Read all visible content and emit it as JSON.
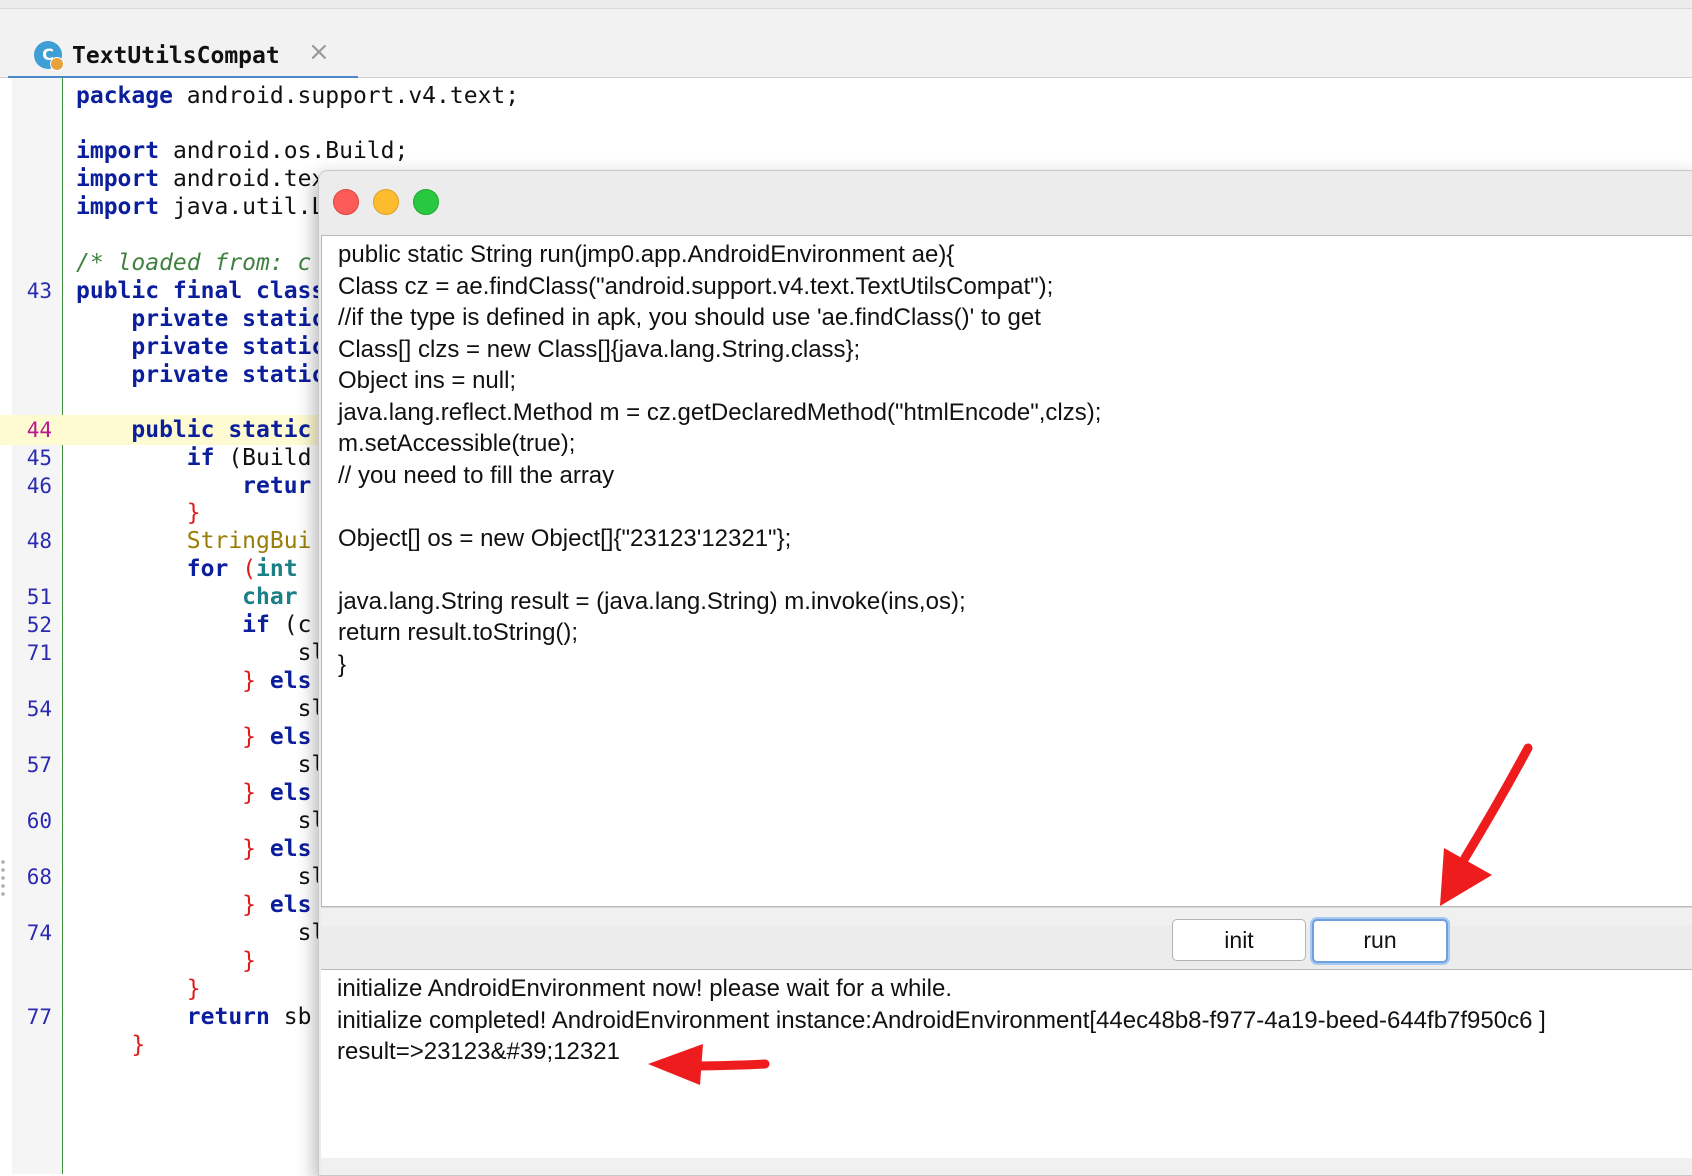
{
  "editor_tab": {
    "icon_letter": "C",
    "title": "TextUtilsCompat",
    "close": "×"
  },
  "code": {
    "package_kw": "package",
    "package_name": " android.support.v4.text;",
    "import_kw": "import",
    "imports": [
      " android.os.Build;",
      " android.tex",
      " java.util.L"
    ],
    "comment": "/* loaded from: c",
    "class_decl_kw": "public final class",
    "private_kw": "private static",
    "method_kw": "public static",
    "if_kw": "if",
    "if_rest": " (Build",
    "return_kw": "return",
    "return_partial": "retur",
    "builder": "StringBui",
    "for_kw": "for",
    "int_kw": "int",
    "char_kw": "char",
    "if_c": " (c",
    "else_kw": "else",
    "else_partial": "els",
    "sb_partial": "sl",
    "return_sb": " sb",
    "line_numbers": {
      "l43": "43",
      "l44": "44",
      "l45": "45",
      "l46": "46",
      "l48": "48",
      "l51": "51",
      "l52": "52",
      "l71": "71",
      "l54": "54",
      "l57": "57",
      "l60": "60",
      "l68": "68",
      "l74": "74",
      "l77": "77"
    }
  },
  "dialog": {
    "script_lines": [
      "public static String run(jmp0.app.AndroidEnvironment ae){",
      "Class cz = ae.findClass(\"android.support.v4.text.TextUtilsCompat\");",
      "//if the type is defined in apk, you should use 'ae.findClass()' to get",
      "Class[] clzs = new Class[]{java.lang.String.class};",
      "Object ins = null;",
      "java.lang.reflect.Method m = cz.getDeclaredMethod(\"htmlEncode\",clzs);",
      "m.setAccessible(true);",
      "// you need to fill the array",
      "",
      "Object[] os = new Object[]{\"23123'12321\"};",
      "",
      "java.lang.String result = (java.lang.String) m.invoke(ins,os);",
      "return result.toString();",
      "}"
    ],
    "buttons": {
      "init": "init",
      "run": "run"
    },
    "console_lines": [
      "initialize AndroidEnvironment now! please wait for a while.",
      "initialize completed! AndroidEnvironment instance:AndroidEnvironment[44ec48b8-f977-4a19-beed-644fb7f950c6 ]",
      "result=>23123&#39;12321"
    ]
  },
  "colors": {
    "annotation_arrow": "#ee1c1c",
    "keyword": "#0b1e9c",
    "comment": "#3f7f3f"
  }
}
